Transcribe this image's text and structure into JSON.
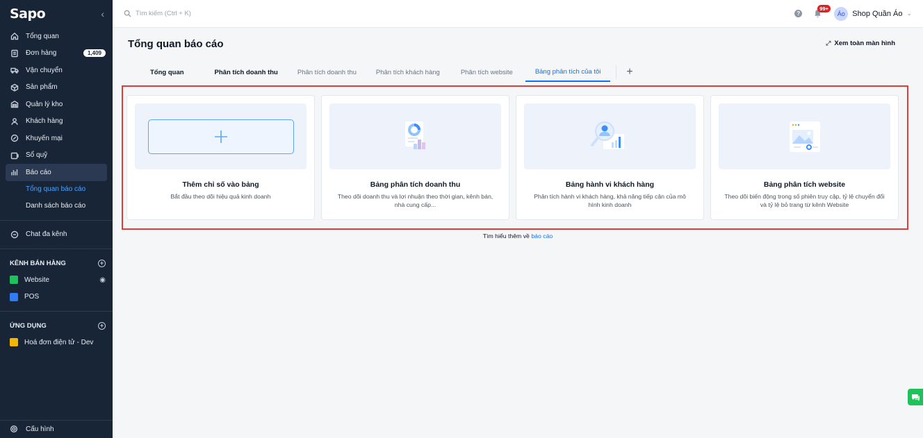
{
  "sidebar": {
    "logo": "Sapo",
    "collapse_icon": "chevron-left-icon",
    "items": [
      {
        "label": "Tổng quan",
        "icon": "home-icon"
      },
      {
        "label": "Đơn hàng",
        "icon": "order-icon",
        "badge": "1,409"
      },
      {
        "label": "Vận chuyển",
        "icon": "truck-icon"
      },
      {
        "label": "Sản phẩm",
        "icon": "box-icon"
      },
      {
        "label": "Quản lý kho",
        "icon": "warehouse-icon"
      },
      {
        "label": "Khách hàng",
        "icon": "user-icon"
      },
      {
        "label": "Khuyến mại",
        "icon": "promo-icon"
      },
      {
        "label": "Sổ quỹ",
        "icon": "cashbook-icon"
      },
      {
        "label": "Báo cáo",
        "icon": "chart-icon"
      }
    ],
    "report_sub": [
      {
        "label": "Tổng quan báo cáo"
      },
      {
        "label": "Danh sách báo cáo"
      }
    ],
    "chat": "Chat đa kênh",
    "sales_channels_title": "KÊNH BÁN HÀNG",
    "channels": [
      {
        "label": "Website",
        "color": "#1ec15a"
      },
      {
        "label": "POS",
        "color": "#2f7cf6"
      }
    ],
    "apps_title": "ỨNG DỤNG",
    "apps": [
      {
        "label": "Hoá đơn điện tử - Dev",
        "color": "#f2b705"
      }
    ],
    "config": "Cấu hình"
  },
  "topbar": {
    "search_placeholder": "Tìm kiếm (Ctrl + K)",
    "notifications": "99+",
    "avatar": "Áo",
    "shop_name": "Shop Quần Áo"
  },
  "main": {
    "title": "Tổng quan báo cáo",
    "fullscreen": "Xem toàn màn hình",
    "tabs": [
      {
        "label": "Tổng quan"
      },
      {
        "label": "Phân tích doanh thu"
      },
      {
        "label": "Phân tích doanh thu"
      },
      {
        "label": "Phân tích khách hàng"
      },
      {
        "label": "Phân tích website"
      },
      {
        "label": "Bảng phân tích của tôi"
      }
    ],
    "cards": [
      {
        "title": "Thêm chỉ số vào bảng",
        "desc": "Bắt đầu theo dõi hiệu quả kinh doanh"
      },
      {
        "title": "Bảng phân tích doanh thu",
        "desc": "Theo dõi doanh thu và lợi nhuận theo thời gian, kênh bán, nhà cung cấp..."
      },
      {
        "title": "Bảng hành vi khách hàng",
        "desc": "Phân tích hành vi khách hàng, khả năng tiếp cận của mô hình kinh doanh"
      },
      {
        "title": "Bảng phân tích website",
        "desc": "Theo dõi biến động trong số phiên truy cập, tỷ lệ chuyển đổi và tỷ lệ bỏ trang từ kênh Website"
      }
    ],
    "footer_prefix": "Tìm hiểu thêm về",
    "footer_link": "báo cáo"
  }
}
